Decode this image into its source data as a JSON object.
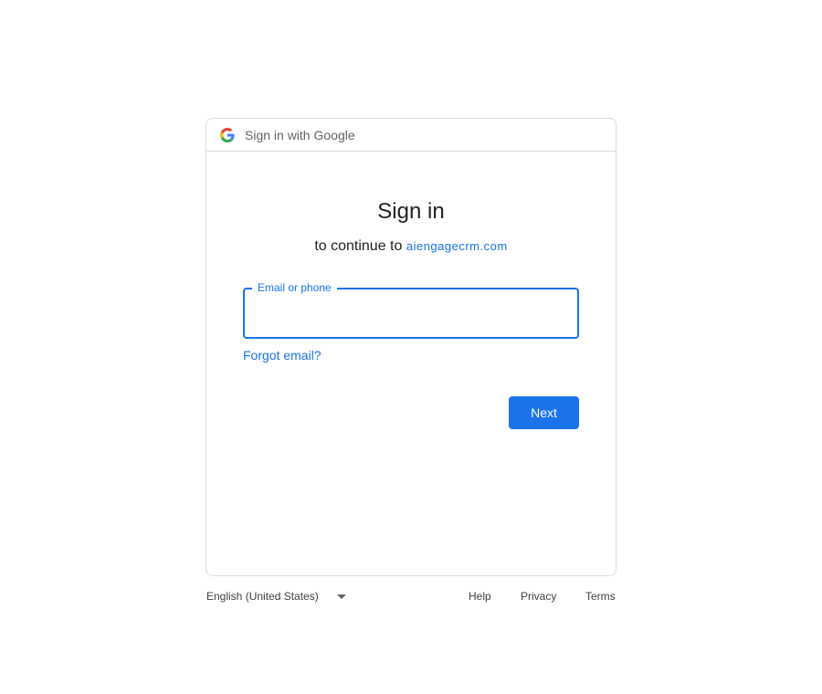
{
  "header": {
    "icon": "google-g-icon",
    "text": "Sign in with Google"
  },
  "main": {
    "title": "Sign in",
    "subtitle_prefix": "to continue to",
    "subtitle_domain": "aiengagecrm.com",
    "email_field": {
      "label": "Email or phone",
      "value": "",
      "placeholder": ""
    },
    "forgot_email": "Forgot email?",
    "next_label": "Next"
  },
  "footer": {
    "language": "English (United States)",
    "language_caret_icon": "caret-down-icon",
    "links": {
      "help": "Help",
      "privacy": "Privacy",
      "terms": "Terms"
    }
  },
  "colors": {
    "accent": "#1a73e8",
    "border": "#dadce0",
    "text": "#202124",
    "muted": "#5f6368"
  }
}
